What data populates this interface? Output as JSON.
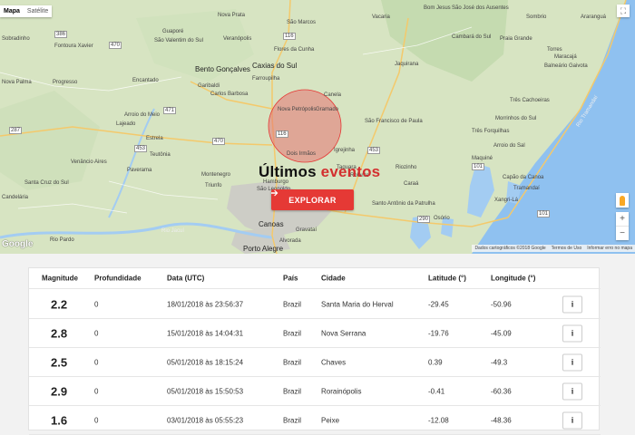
{
  "map": {
    "type_tabs": [
      "Mapa",
      "Satélite"
    ],
    "attribution": [
      "Dados cartográficos ©2018 Google",
      "Termos de Uso",
      "Informar erro no mapa"
    ],
    "google_logo": "Google",
    "zoom_in": "+",
    "zoom_out": "−",
    "cities": [
      {
        "name": "Caxias do Sul",
        "big": true
      },
      {
        "name": "Bento Gonçalves",
        "big": true
      },
      {
        "name": "Farroupilha"
      },
      {
        "name": "Garibaldi"
      },
      {
        "name": "Carlos Barbosa"
      },
      {
        "name": "Nova Petrópolis"
      },
      {
        "name": "Gramado"
      },
      {
        "name": "Canela"
      },
      {
        "name": "São Francisco de Paula"
      },
      {
        "name": "Dois Irmãos"
      },
      {
        "name": "Igrejinha"
      },
      {
        "name": "Taquara"
      },
      {
        "name": "Lajeado"
      },
      {
        "name": "Arroio do Meio"
      },
      {
        "name": "Estrela"
      },
      {
        "name": "Montenegro"
      },
      {
        "name": "Santa Cruz do Sul"
      },
      {
        "name": "Venâncio Aires"
      },
      {
        "name": "Canoas",
        "big": true
      },
      {
        "name": "Gravataí"
      },
      {
        "name": "Porto Alegre",
        "big": true
      },
      {
        "name": "Alvorada"
      },
      {
        "name": "Santo Antônio da Patrulha"
      },
      {
        "name": "Osório"
      },
      {
        "name": "Rolante"
      },
      {
        "name": "Riozinho"
      },
      {
        "name": "Cambará do Sul"
      },
      {
        "name": "Jaquirana"
      },
      {
        "name": "Bom Jesus"
      },
      {
        "name": "São José dos Ausentes"
      },
      {
        "name": "Praia Grande"
      },
      {
        "name": "Sombrio"
      },
      {
        "name": "Araranguá"
      },
      {
        "name": "Maracajá"
      },
      {
        "name": "Balneário Gaivota"
      },
      {
        "name": "Torres"
      },
      {
        "name": "Arroio do Sal"
      },
      {
        "name": "Capão da Canoa"
      },
      {
        "name": "Tramandaí"
      },
      {
        "name": "Xangri-Lá"
      },
      {
        "name": "Rio Tramandaí",
        "water": true
      },
      {
        "name": "Rio Jacuí",
        "water": true
      },
      {
        "name": "Hamburgo"
      },
      {
        "name": "São Leopoldo"
      },
      {
        "name": "Encantado"
      },
      {
        "name": "Veranópolis"
      },
      {
        "name": "Nova Prata"
      },
      {
        "name": "Guaporé"
      },
      {
        "name": "Flores da Cunha"
      },
      {
        "name": "São Marcos"
      },
      {
        "name": "Vacaria"
      },
      {
        "name": "São Valentim do Sul"
      },
      {
        "name": "Fontoura Xavier"
      },
      {
        "name": "Progresso"
      },
      {
        "name": "Teutônia"
      },
      {
        "name": "Triunfo"
      },
      {
        "name": "Candelária"
      },
      {
        "name": "Rio Pardo"
      },
      {
        "name": "Nova Palma"
      },
      {
        "name": "Paverama"
      },
      {
        "name": "Sobradinho"
      },
      {
        "name": "Caraá"
      },
      {
        "name": "Três Cachoeiras"
      },
      {
        "name": "Morrinhos do Sul"
      },
      {
        "name": "Três Forquilhas"
      },
      {
        "name": "Maquiné"
      }
    ],
    "road_shields": [
      "116",
      "386",
      "453",
      "470",
      "471",
      "287",
      "290",
      "101",
      "453",
      "116",
      "470",
      "101"
    ]
  },
  "hero": {
    "title_part1": "Últimos ",
    "title_part2": "eventos",
    "explore_label": "EXPLORAR",
    "explore_icon": "arrow-right-icon"
  },
  "table": {
    "headers": [
      "Magnitude",
      "Profundidade",
      "Data (UTC)",
      "País",
      "Cidade",
      "Latitude (°)",
      "Longitude (°)"
    ],
    "info_icon": "i",
    "rows": [
      {
        "magnitude": "2.2",
        "depth": "0",
        "date": "18/01/2018 às 23:56:37",
        "country": "Brazil",
        "city": "Santa Maria do Herval",
        "lat": "-29.45",
        "lon": "-50.96"
      },
      {
        "magnitude": "2.8",
        "depth": "0",
        "date": "15/01/2018 às 14:04:31",
        "country": "Brazil",
        "city": "Nova Serrana",
        "lat": "-19.76",
        "lon": "-45.09"
      },
      {
        "magnitude": "2.5",
        "depth": "0",
        "date": "05/01/2018 às 18:15:24",
        "country": "Brazil",
        "city": "Chaves",
        "lat": "0.39",
        "lon": "-49.3"
      },
      {
        "magnitude": "2.9",
        "depth": "0",
        "date": "05/01/2018 às 15:50:53",
        "country": "Brazil",
        "city": "Rorainópolis",
        "lat": "-0.41",
        "lon": "-60.36"
      },
      {
        "magnitude": "1.6",
        "depth": "0",
        "date": "03/01/2018 às 05:55:23",
        "country": "Brazil",
        "city": "Peixe",
        "lat": "-12.08",
        "lon": "-48.36"
      }
    ]
  },
  "colors": {
    "accent": "#e53935",
    "land": "#d9e6c4",
    "water": "#8fc1f0",
    "urban": "#c9c9c9",
    "circle": "#e57373"
  }
}
